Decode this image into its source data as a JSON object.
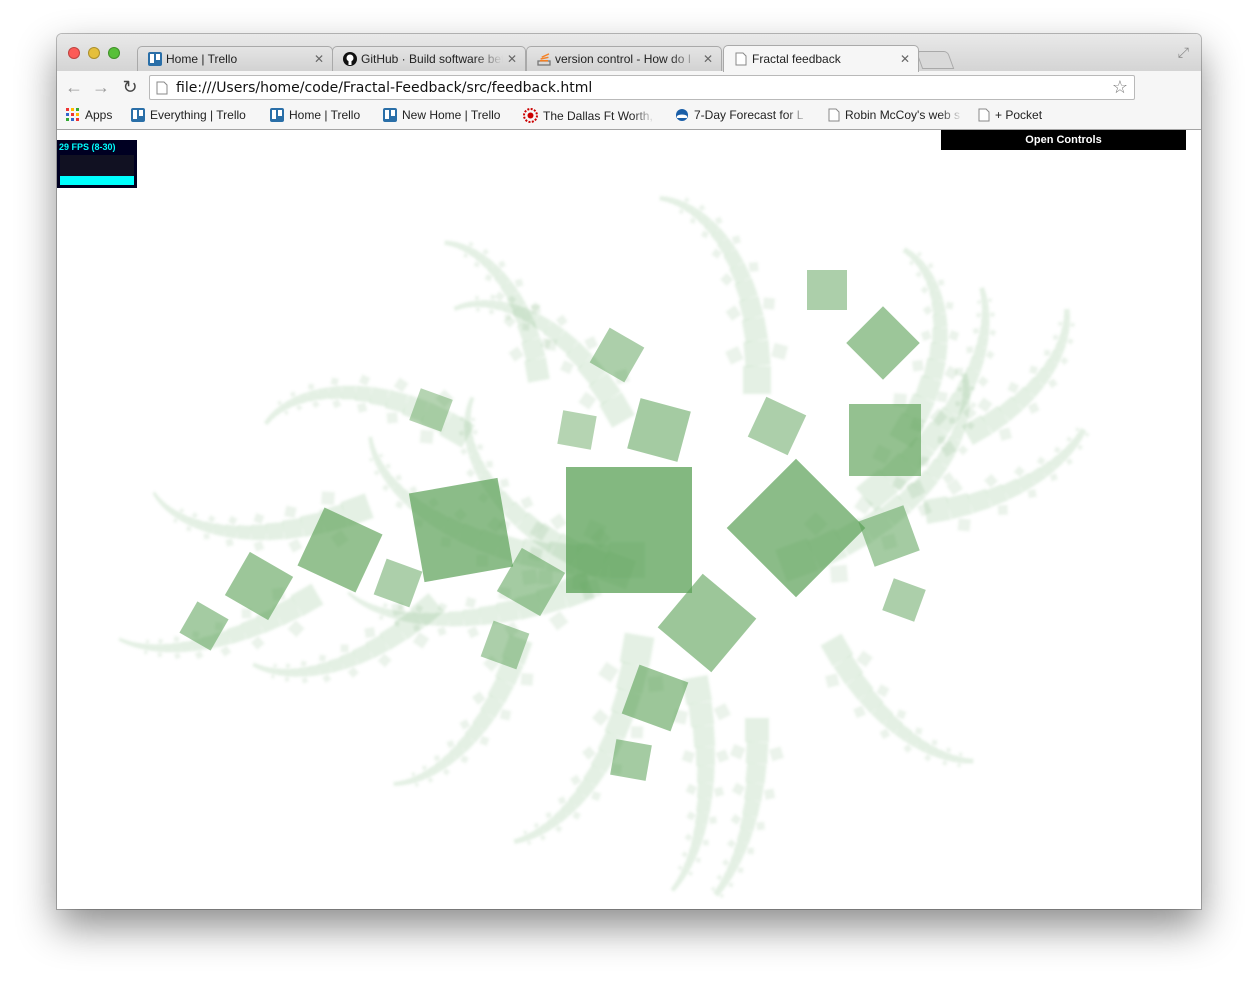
{
  "tabs": [
    {
      "title": "Home | Trello",
      "icon": "trello-icon"
    },
    {
      "title": "GitHub · Build software better",
      "icon": "github-icon"
    },
    {
      "title": "version control - How do I",
      "icon": "stackoverflow-icon"
    },
    {
      "title": "Fractal feedback",
      "icon": "page-icon",
      "active": true
    }
  ],
  "address": {
    "url": "file:///Users/home/code/Fractal-Feedback/src/feedback.html"
  },
  "bookmarks": [
    {
      "label": "Apps",
      "icon": "apps-grid-icon"
    },
    {
      "label": "Everything | Trello",
      "icon": "trello-icon"
    },
    {
      "label": "Home | Trello",
      "icon": "trello-icon"
    },
    {
      "label": "New Home | Trello",
      "icon": "trello-icon"
    },
    {
      "label": "The Dallas Ft Worth,",
      "icon": "sun-icon"
    },
    {
      "label": "7-Day Forecast for L",
      "icon": "noaa-icon"
    },
    {
      "label": "Robin McCoy's web s",
      "icon": "page-icon"
    },
    {
      "label": "+ Pocket",
      "icon": "page-icon"
    }
  ],
  "stats": {
    "fps_label": "29 FPS (8-30)"
  },
  "controls": {
    "open_label": "Open Controls"
  },
  "colors": {
    "fractal": "#5aa055",
    "stats_text": "#00ffff",
    "stats_bg": "#000022"
  }
}
